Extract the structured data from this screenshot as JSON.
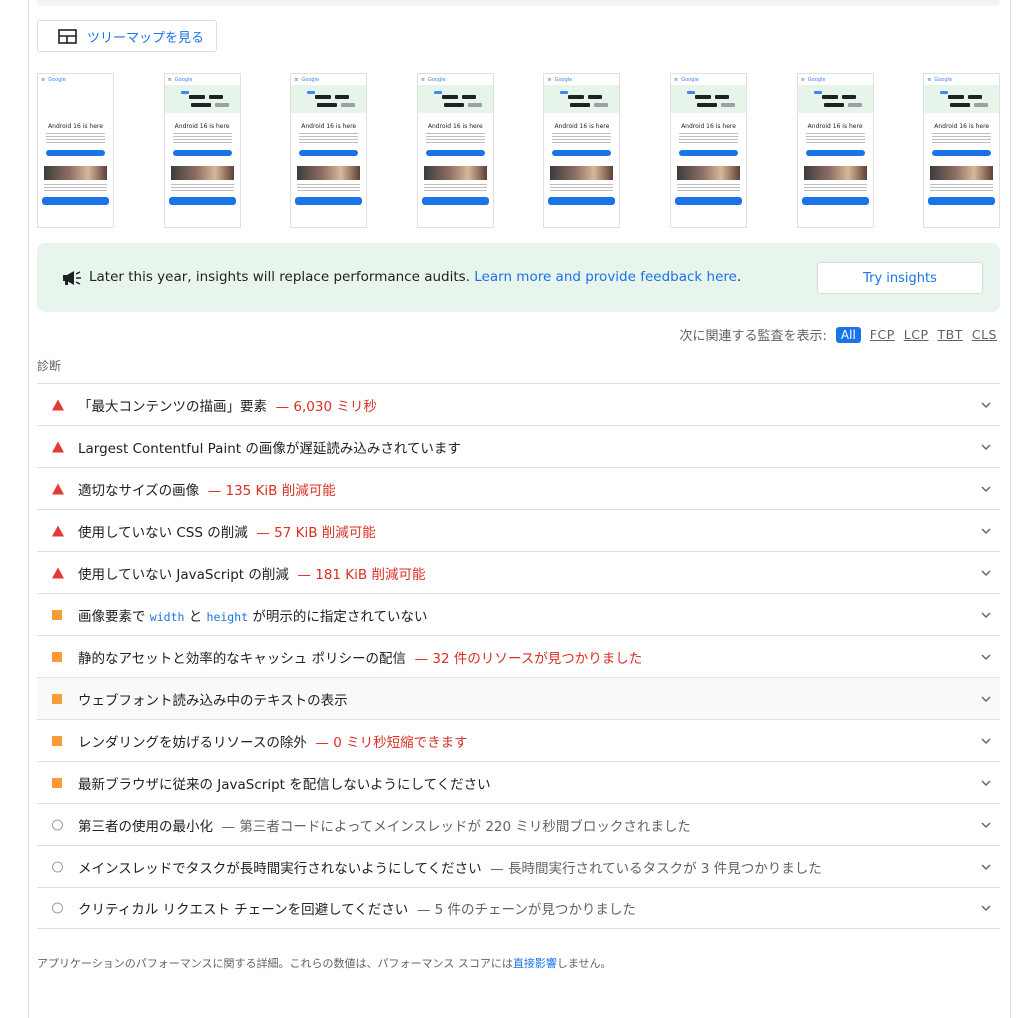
{
  "treemap": {
    "label": "ツリーマップを見る"
  },
  "filmstrip": {
    "frame_count": 8,
    "frame": {
      "brand": "Google",
      "title": "Android 16 is here"
    }
  },
  "insights": {
    "message": "Later this year, insights will replace performance audits.",
    "link": "Learn more and provide feedback here",
    "period": ".",
    "button": "Try insights"
  },
  "filter": {
    "label": "次に関連する監査を表示:",
    "options": [
      "All",
      "FCP",
      "LCP",
      "TBT",
      "CLS"
    ],
    "selected": "All"
  },
  "section_title": "診断",
  "audits": [
    {
      "icon": "fail-triangle-icon",
      "title": "「最大コンテンツの描画」要素",
      "display": "— 6,030 ミリ秒",
      "display_color": "#d93025"
    },
    {
      "icon": "fail-triangle-icon",
      "title": "Largest Contentful Paint の画像が遅延読み込みされています",
      "display": ""
    },
    {
      "icon": "fail-triangle-icon",
      "title": "適切なサイズの画像",
      "display": "— 135 KiB 削減可能",
      "display_color": "#d93025"
    },
    {
      "icon": "fail-triangle-icon",
      "title": "使用していない CSS の削減",
      "display": "— 57 KiB 削減可能",
      "display_color": "#d93025"
    },
    {
      "icon": "fail-triangle-icon",
      "title": "使用していない JavaScript の削減",
      "display": "— 181 KiB 削減可能",
      "display_color": "#d93025"
    },
    {
      "icon": "average-square-icon",
      "title_parts": [
        "画像要素で ",
        "width",
        " と ",
        "height",
        " が明示的に指定されていない"
      ],
      "display": ""
    },
    {
      "icon": "average-square-icon",
      "title": "静的なアセットと効率的なキャッシュ ポリシーの配信",
      "display": "— 32 件のリソースが見つかりました",
      "display_color": "#d93025"
    },
    {
      "icon": "average-square-icon",
      "title": "ウェブフォント読み込み中のテキストの表示",
      "display": ""
    },
    {
      "icon": "average-square-icon",
      "title": "レンダリングを妨げるリソースの除外",
      "display": "— 0 ミリ秒短縮できます",
      "display_color": "#d93025"
    },
    {
      "icon": "average-square-icon",
      "title": "最新ブラウザに従来の JavaScript を配信しないようにしてください",
      "display": ""
    },
    {
      "icon": "info-circle-icon",
      "title": "第三者の使用の最小化",
      "display": "— 第三者コードによってメインスレッドが 220 ミリ秒間ブロックされました",
      "display_color": "#5f6368"
    },
    {
      "icon": "info-circle-icon",
      "title": "メインスレッドでタスクが長時間実行されないようにしてください",
      "display": "— 長時間実行されているタスクが 3 件見つかりました",
      "display_color": "#5f6368"
    },
    {
      "icon": "info-circle-icon",
      "title": "クリティカル リクエスト チェーンを回避してください",
      "display": "— 5 件のチェーンが見つかりました",
      "display_color": "#5f6368"
    }
  ],
  "footer": {
    "text_before": "アプリケーションのパフォーマンスに関する詳細。これらの数値は、パフォーマンス スコアには",
    "link": "直接影響",
    "text_after": "しません。"
  },
  "colors": {
    "accent": "#1a73e8",
    "fail": "#e53935",
    "average": "#fa9b36",
    "insights_bg": "#e8f5ec"
  }
}
